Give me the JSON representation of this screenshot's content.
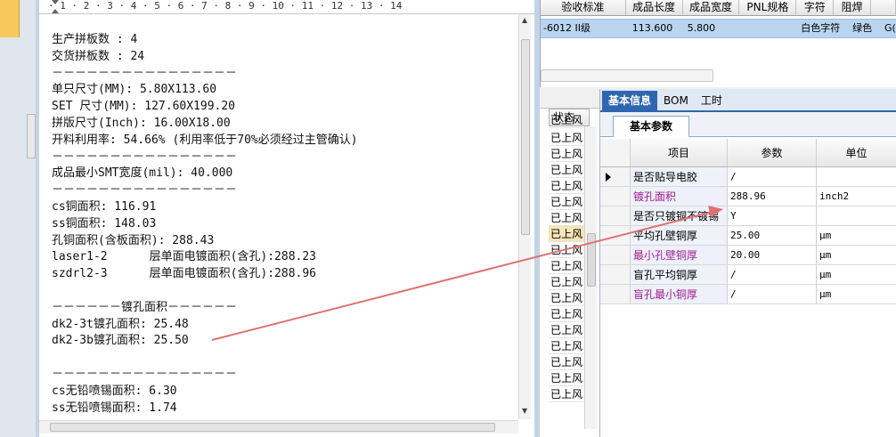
{
  "notepad": {
    "ruler": "· 1 · 2 · 3 · 4 · 5 · 6 · 7 · 8 · 9 · 10 · 11 · 12 · 13 · 14",
    "lines": [
      "生产拼板数 : 4",
      "交货拼板数 : 24",
      "－－－－－－－－－－－－－－－－",
      "单只尺寸(MM): 5.80X113.60",
      "SET 尺寸(MM): 127.60X199.20",
      "拼版尺寸(Inch): 16.00X18.00",
      "开料利用率: 54.66% (利用率低于70%必须经过主管确认)",
      "－－－－－－－－－－－－－－－－",
      "成品最小SMT宽度(mil): 40.000",
      "－－－－－－－－－－－－－－－－",
      "cs铜面积: 116.91",
      "ss铜面积: 148.03",
      "孔铜面积(含板面积): 288.43",
      "laser1-2      层单面电镀面积(含孔):288.23",
      "szdrl2-3      层单面电镀面积(含孔):288.96",
      "",
      "－－－－－－镀孔面积－－－－－－",
      "dk2-3t镀孔面积: 25.48",
      "dk2-3b镀孔面积: 25.50",
      "",
      "－－－－－－－－－－－－－－－－",
      "cs无铅喷锡面积: 6.30",
      "ss无铅喷锡面积: 1.74"
    ]
  },
  "top_grid": {
    "headers": [
      "验收标准",
      "成品长度",
      "成品宽度",
      "PNL规格",
      "字符",
      "阻焊",
      ""
    ],
    "row": [
      "-6012 II级",
      "113.600",
      "5.800",
      "",
      "白色字符",
      "绿色",
      "G("
    ]
  },
  "status": {
    "header": "状态",
    "cells": [
      "已上风",
      "已上风",
      "已上风",
      "已上风",
      "已上风",
      "已上风",
      "已上风",
      "已上风",
      "已上风",
      "已上风",
      "已上风",
      "已上风",
      "已上风",
      "已上风",
      "已上风",
      "已上风",
      "已上风",
      "已上风"
    ]
  },
  "right_panel": {
    "tabs": [
      "基本信息",
      "BOM",
      "工时"
    ],
    "subtab": "基本参数",
    "table_headers": [
      "项目",
      "参数",
      "单位"
    ],
    "rows": [
      {
        "item": "是否贴导电胶",
        "value": "/",
        "unit": ""
      },
      {
        "item": "镀孔面积",
        "value": "288.96",
        "unit": "inch2"
      },
      {
        "item": "是否只镀铜不镀锡",
        "value": "Y",
        "unit": ""
      },
      {
        "item": "平均孔壁铜厚",
        "value": "25.00",
        "unit": "μm"
      },
      {
        "item": "最小孔壁铜厚",
        "value": "20.00",
        "unit": "μm"
      },
      {
        "item": "盲孔平均铜厚",
        "value": "/",
        "unit": "μm"
      },
      {
        "item": "盲孔最小铜厚",
        "value": "/",
        "unit": "μm"
      }
    ]
  },
  "colors": {
    "accent_blue": "#2f66b0",
    "row_selected": "#b9d4ef",
    "purple_text": "#a0208f",
    "annotation_red": "#e05a5a"
  }
}
